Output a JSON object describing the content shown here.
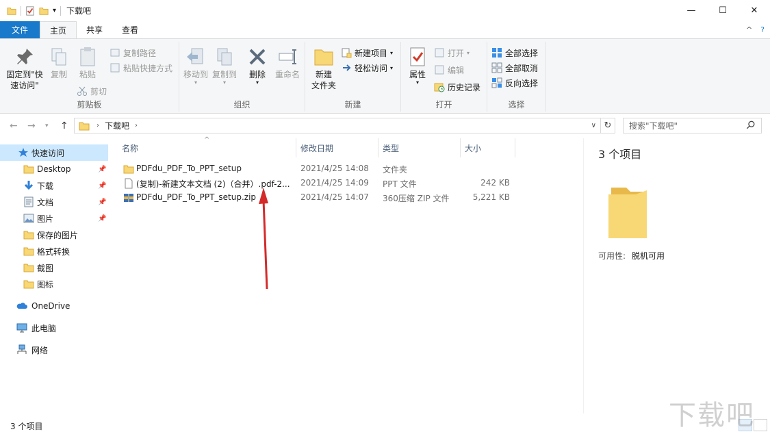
{
  "window": {
    "title": "下载吧",
    "minimize": "—",
    "maximize": "☐",
    "close": "✕"
  },
  "tabs": [
    {
      "label": "文件"
    },
    {
      "label": "主页"
    },
    {
      "label": "共享"
    },
    {
      "label": "查看"
    }
  ],
  "ribbon": {
    "clipboard": {
      "group_label": "剪贴板",
      "pin_quick": "固定到\"快速访问\"",
      "copy": "复制",
      "paste": "粘贴",
      "copy_path": "复制路径",
      "paste_shortcut": "粘贴快捷方式",
      "cut": "剪切"
    },
    "organize": {
      "group_label": "组织",
      "move_to": "移动到",
      "copy_to": "复制到",
      "delete": "删除",
      "rename": "重命名"
    },
    "new": {
      "group_label": "新建",
      "new_folder": "新建\n文件夹",
      "new_item": "新建项目",
      "easy_access": "轻松访问"
    },
    "open": {
      "group_label": "打开",
      "properties": "属性",
      "open": "打开",
      "edit": "编辑",
      "history": "历史记录"
    },
    "select": {
      "group_label": "选择",
      "select_all": "全部选择",
      "select_none": "全部取消",
      "invert": "反向选择"
    }
  },
  "address": {
    "crumb": "下载吧",
    "search_placeholder": "搜索\"下载吧\""
  },
  "nav": {
    "items": [
      {
        "label": "快速访问",
        "icon": "star-icon"
      },
      {
        "label": "Desktop",
        "icon": "folder-icon",
        "pinned": true
      },
      {
        "label": "下载",
        "icon": "download-icon",
        "pinned": true
      },
      {
        "label": "文档",
        "icon": "document-icon",
        "pinned": true
      },
      {
        "label": "图片",
        "icon": "picture-icon",
        "pinned": true
      },
      {
        "label": "保存的图片",
        "icon": "folder-icon"
      },
      {
        "label": "格式转换",
        "icon": "folder-icon"
      },
      {
        "label": "截图",
        "icon": "folder-icon"
      },
      {
        "label": "图标",
        "icon": "folder-icon"
      },
      {
        "label": "OneDrive",
        "icon": "cloud-icon"
      },
      {
        "label": "此电脑",
        "icon": "computer-icon"
      },
      {
        "label": "网络",
        "icon": "network-icon"
      }
    ]
  },
  "columns": {
    "name": "名称",
    "date": "修改日期",
    "type": "类型",
    "size": "大小"
  },
  "files": [
    {
      "name": "PDFdu_PDF_To_PPT_setup",
      "date": "2021/4/25 14:08",
      "type": "文件夹",
      "size": "",
      "icon": "folder-icon"
    },
    {
      "name": "(复制)-新建文本文档 (2)（合并）.pdf-2...",
      "date": "2021/4/25 14:09",
      "type": "PPT 文件",
      "size": "242 KB",
      "icon": "file-icon"
    },
    {
      "name": "PDFdu_PDF_To_PPT_setup.zip",
      "date": "2021/4/25 14:07",
      "type": "360压缩 ZIP 文件",
      "size": "5,221 KB",
      "icon": "zip-icon"
    }
  ],
  "details": {
    "count": "3 个项目",
    "availability_label": "可用性:",
    "availability_value": "脱机可用"
  },
  "status": {
    "count": "3 个项目"
  },
  "watermark": "下载吧",
  "colors": {
    "accent": "#1979ca",
    "selection": "#cce8ff",
    "folder": "#f8d775",
    "arrow": "#d42a2a"
  }
}
